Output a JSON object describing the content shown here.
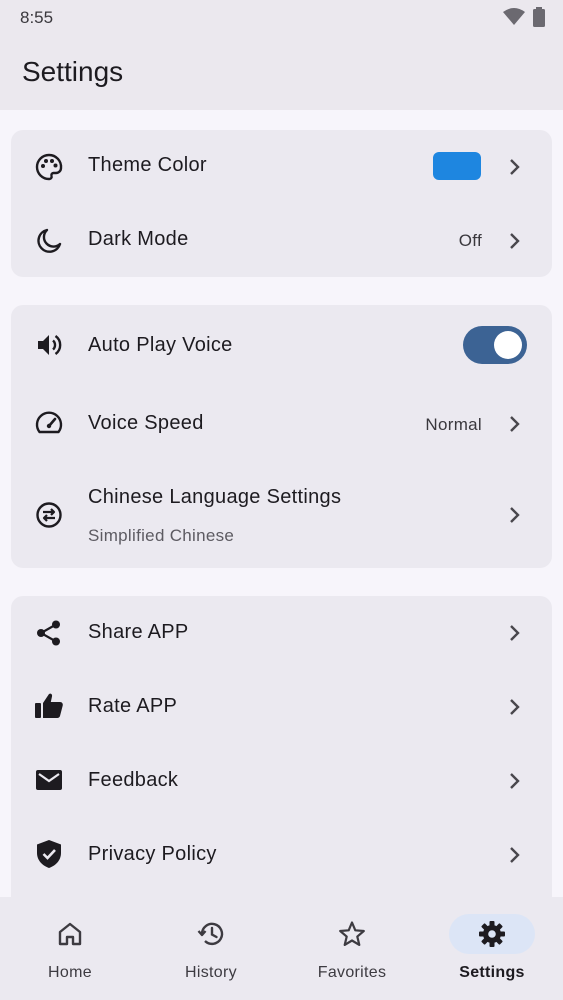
{
  "status_bar": {
    "time": "8:55"
  },
  "app_bar": {
    "title": "Settings"
  },
  "appearance": {
    "theme_color": {
      "label": "Theme Color",
      "color": "#1e86e0"
    },
    "dark_mode": {
      "label": "Dark Mode",
      "value": "Off"
    }
  },
  "voice": {
    "auto_play": {
      "label": "Auto Play Voice",
      "enabled": true
    },
    "speed": {
      "label": "Voice Speed",
      "value": "Normal"
    },
    "chinese": {
      "label": "Chinese Language Settings",
      "value": "Simplified Chinese"
    }
  },
  "about": {
    "share": {
      "label": "Share APP"
    },
    "rate": {
      "label": "Rate APP"
    },
    "feedback": {
      "label": "Feedback"
    },
    "privacy": {
      "label": "Privacy Policy"
    }
  },
  "bottom_nav": {
    "items": [
      {
        "label": "Home",
        "icon": "home-icon",
        "active": false
      },
      {
        "label": "History",
        "icon": "history-icon",
        "active": false
      },
      {
        "label": "Favorites",
        "icon": "star-icon",
        "active": false
      },
      {
        "label": "Settings",
        "icon": "gear-icon",
        "active": true
      }
    ]
  },
  "colors": {
    "accent": "#3c6394",
    "active_pill": "#dce5f6",
    "card": "#ebe9f0"
  }
}
